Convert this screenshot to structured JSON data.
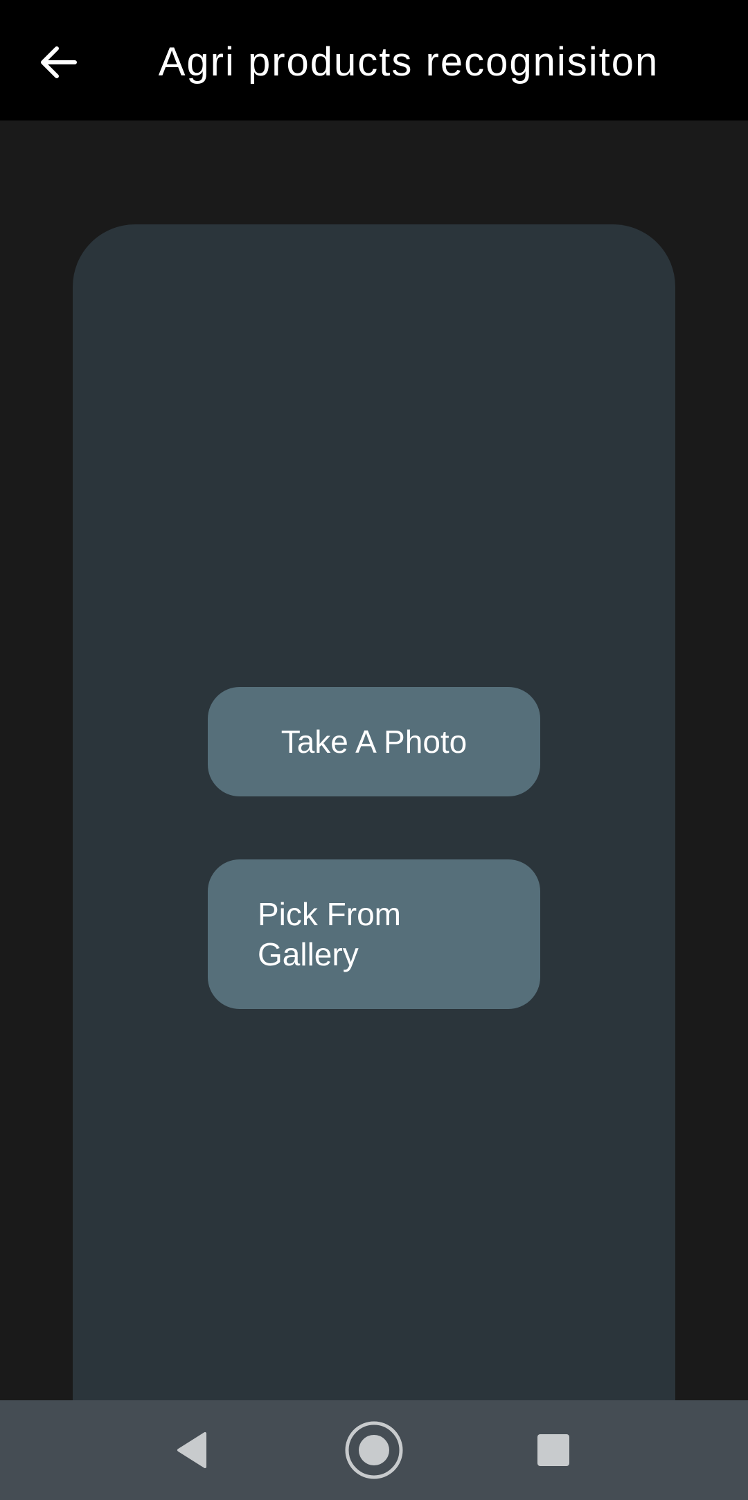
{
  "app_bar": {
    "title": "Agri products recognisiton",
    "back_icon": "arrow-left-icon"
  },
  "actions": {
    "take_photo_label": "Take A Photo",
    "pick_gallery_label": "Pick From Gallery"
  },
  "system_nav": {
    "back_icon": "triangle-back-icon",
    "home_icon": "circle-home-icon",
    "recents_icon": "square-recents-icon"
  },
  "colors": {
    "app_bar_bg": "#000000",
    "background": "#1a1a1a",
    "card_bg": "#2b353b",
    "button_bg": "#566f7a",
    "nav_bar_bg": "#454d54"
  }
}
